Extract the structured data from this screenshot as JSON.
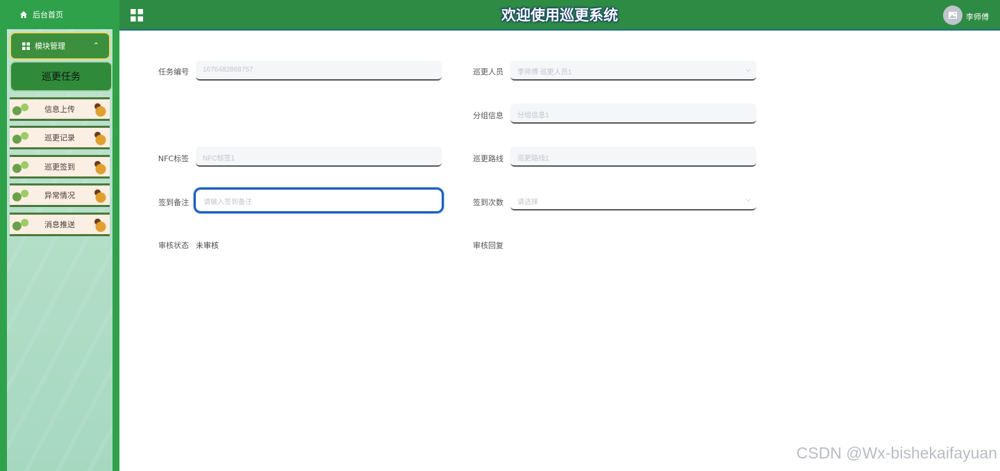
{
  "sidebar": {
    "home_label": "后台首页",
    "module_label": "模块管理",
    "active_item": "巡更任务",
    "items": [
      {
        "label": "信息上传"
      },
      {
        "label": "巡更记录"
      },
      {
        "label": "巡更签到"
      },
      {
        "label": "异常情况"
      },
      {
        "label": "消息推送"
      }
    ]
  },
  "header": {
    "title": "欢迎使用巡更系统",
    "user_name": "李师傅"
  },
  "form": {
    "task_no": {
      "label": "任务编号",
      "value": "1676482868757"
    },
    "patrol_person": {
      "label": "巡更人员",
      "value": "李师傅 巡更人员1"
    },
    "group_info": {
      "label": "分组信息",
      "value": "分组信息1"
    },
    "nfc_tag": {
      "label": "NFC标签",
      "value": "NFC标签1"
    },
    "patrol_route": {
      "label": "巡更路线",
      "value": "巡更路线1"
    },
    "sign_remark": {
      "label": "签到备注",
      "placeholder": "请输入签到备注"
    },
    "sign_count": {
      "label": "签到次数",
      "placeholder": "请选择"
    },
    "review_status": {
      "label": "审核状态",
      "value": "未审核"
    },
    "review_reply": {
      "label": "审核回复",
      "value": ""
    }
  },
  "watermark": "CSDN @Wx-bishekaifayuan"
}
